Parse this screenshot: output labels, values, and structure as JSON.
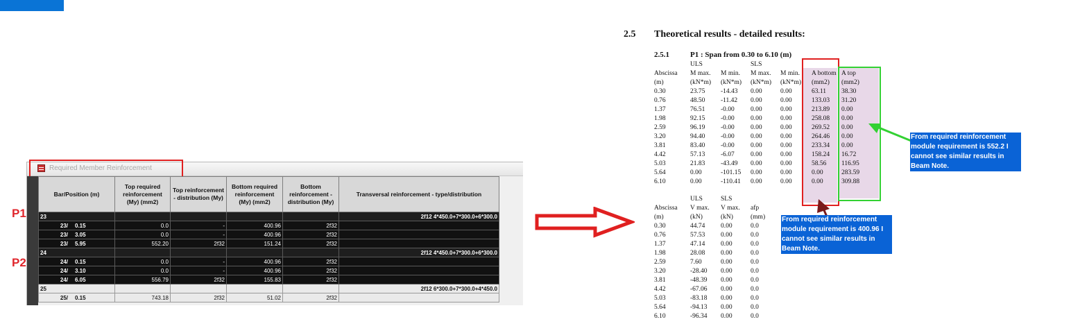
{
  "window": {
    "title": "Required Member Reinforcement",
    "columns": [
      "Bar/Position (m)",
      "Top required reinforcement (My) (mm2)",
      "Top reinforcement - distribution (My)",
      "Bottom required reinforcement (My) (mm2)",
      "Bottom reinforcement - distribution (My)",
      "Transversal reinforcement - type/distribution"
    ],
    "groups": [
      {
        "bar": "23",
        "transversal": "2f12 4*450.0+7*300.0+6*300.0",
        "rows": [
          {
            "bar": "23/",
            "pos": "0.15",
            "top_req": "0.0",
            "top_dist": "-",
            "bot_req": "400.96",
            "bot_dist": "2f32"
          },
          {
            "bar": "23/",
            "pos": "3.05",
            "top_req": "0.0",
            "top_dist": "-",
            "bot_req": "400.96",
            "bot_dist": "2f32"
          },
          {
            "bar": "23/",
            "pos": "5.95",
            "top_req": "552.20",
            "top_dist": "2f32",
            "bot_req": "151.24",
            "bot_dist": "2f32"
          }
        ]
      },
      {
        "bar": "24",
        "transversal": "2f12 4*450.0+7*300.0+6*300.0",
        "rows": [
          {
            "bar": "24/",
            "pos": "0.15",
            "top_req": "0.0",
            "top_dist": "-",
            "bot_req": "400.96",
            "bot_dist": "2f32"
          },
          {
            "bar": "24/",
            "pos": "3.10",
            "top_req": "0.0",
            "top_dist": "-",
            "bot_req": "400.96",
            "bot_dist": "2f32"
          },
          {
            "bar": "24/",
            "pos": "6.05",
            "top_req": "556.79",
            "top_dist": "2f32",
            "bot_req": "155.83",
            "bot_dist": "2f32"
          }
        ]
      },
      {
        "bar": "25",
        "transversal": "2f12 6*300.0+7*300.0+4*450.0",
        "rows": [
          {
            "bar": "25/",
            "pos": "0.15",
            "top_req": "743.18",
            "top_dist": "2f32",
            "bot_req": "51.02",
            "bot_dist": "2f32"
          }
        ]
      }
    ]
  },
  "labels": {
    "p1": "P1",
    "p2": "P2"
  },
  "doc": {
    "section_number": "2.5",
    "section_title": "Theoretical results - detailed results:",
    "subsection_number": "2.5.1",
    "subsection_title": "P1 : Span from 0.30 to 6.10 (m)",
    "moment_table": {
      "group_uls": "ULS",
      "group_sls": "SLS",
      "headers": [
        "Abscissa",
        "M max.",
        "M min.",
        "M max.",
        "M min.",
        "A bottom",
        "A top"
      ],
      "units": [
        "(m)",
        "(kN*m)",
        "(kN*m)",
        "(kN*m)",
        "(kN*m)",
        "(mm2)",
        "(mm2)"
      ],
      "rows": [
        [
          "0.30",
          "23.75",
          "-14.43",
          "0.00",
          "0.00",
          "63.11",
          "38.30"
        ],
        [
          "0.76",
          "48.50",
          "-11.42",
          "0.00",
          "0.00",
          "133.03",
          "31.20"
        ],
        [
          "1.37",
          "76.51",
          "-0.00",
          "0.00",
          "0.00",
          "213.89",
          "0.00"
        ],
        [
          "1.98",
          "92.15",
          "-0.00",
          "0.00",
          "0.00",
          "258.08",
          "0.00"
        ],
        [
          "2.59",
          "96.19",
          "-0.00",
          "0.00",
          "0.00",
          "269.52",
          "0.00"
        ],
        [
          "3.20",
          "94.40",
          "-0.00",
          "0.00",
          "0.00",
          "264.46",
          "0.00"
        ],
        [
          "3.81",
          "83.40",
          "-0.00",
          "0.00",
          "0.00",
          "233.34",
          "0.00"
        ],
        [
          "4.42",
          "57.13",
          "-6.07",
          "0.00",
          "0.00",
          "158.24",
          "16.72"
        ],
        [
          "5.03",
          "21.83",
          "-43.49",
          "0.00",
          "0.00",
          "58.56",
          "116.95"
        ],
        [
          "5.64",
          "0.00",
          "-101.15",
          "0.00",
          "0.00",
          "0.00",
          "283.59"
        ],
        [
          "6.10",
          "0.00",
          "-110.41",
          "0.00",
          "0.00",
          "0.00",
          "309.88"
        ]
      ]
    },
    "shear_table": {
      "group_uls": "ULS",
      "group_sls": "SLS",
      "headers": [
        "Abscissa",
        "V max.",
        "V max.",
        "afp"
      ],
      "units": [
        "(m)",
        "(kN)",
        "(kN)",
        "(mm)"
      ],
      "rows": [
        [
          "0.30",
          "44.74",
          "0.00",
          "0.0"
        ],
        [
          "0.76",
          "57.53",
          "0.00",
          "0.0"
        ],
        [
          "1.37",
          "47.14",
          "0.00",
          "0.0"
        ],
        [
          "1.98",
          "28.08",
          "0.00",
          "0.0"
        ],
        [
          "2.59",
          "7.60",
          "0.00",
          "0.0"
        ],
        [
          "3.20",
          "-28.40",
          "0.00",
          "0.0"
        ],
        [
          "3.81",
          "-48.39",
          "0.00",
          "0.0"
        ],
        [
          "4.42",
          "-67.06",
          "0.00",
          "0.0"
        ],
        [
          "5.03",
          "-83.18",
          "0.00",
          "0.0"
        ],
        [
          "5.64",
          "-94.13",
          "0.00",
          "0.0"
        ],
        [
          "6.10",
          "-96.34",
          "0.00",
          "0.0"
        ]
      ]
    }
  },
  "notes": {
    "top_note": "From required reinforcement module requirement is 552.2 I cannot see similar results in Beam Note.",
    "bottom_note": "From required reinforcement module requirement is 400.96 I cannot see similar results in Beam Note."
  },
  "colors": {
    "highlight_red": "#e02020",
    "highlight_green": "#33d133",
    "note_blue": "#0a63d6",
    "column_fill": "#e8d8e8"
  }
}
